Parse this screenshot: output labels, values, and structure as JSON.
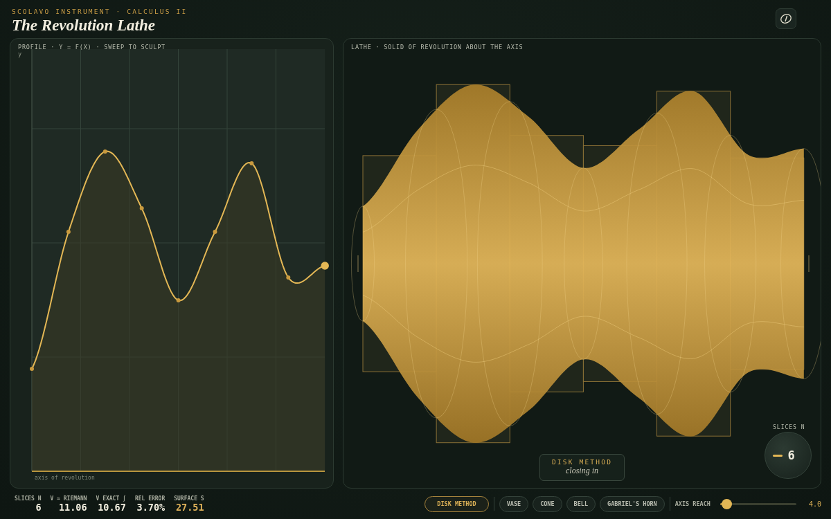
{
  "header": {
    "eyebrow": "SCOLAVO INSTRUMENT · CALCULUS II",
    "title": "The Revolution Lathe"
  },
  "profile_panel": {
    "title": "PROFILE · Y = F(X) · SWEEP TO SCULPT",
    "y_label": "y",
    "axis_label": "axis of revolution"
  },
  "lathe_panel": {
    "title": "LATHE · SOLID OF REVOLUTION ABOUT THE AXIS",
    "method_badge": {
      "title": "DISK METHOD",
      "subtitle": "closing in"
    },
    "slices_knob": {
      "label": "SLICES N",
      "value": "6"
    }
  },
  "stats": [
    {
      "label": "SLICES N",
      "value": "6",
      "highlight": false
    },
    {
      "label": "V ≈ RIEMANN",
      "value": "11.06",
      "highlight": false
    },
    {
      "label": "V EXACT ∫",
      "value": "10.67",
      "highlight": false
    },
    {
      "label": "REL ERROR",
      "value": "3.70%",
      "highlight": false
    },
    {
      "label": "SURFACE S",
      "value": "27.51",
      "highlight": true
    }
  ],
  "presets": [
    {
      "label": "DISK METHOD",
      "selected": true
    },
    {
      "label": "VASE",
      "selected": false
    },
    {
      "label": "CONE",
      "selected": false
    },
    {
      "label": "BELL",
      "selected": false
    },
    {
      "label": "GABRIEL'S HORN",
      "selected": false
    }
  ],
  "axis_reach": {
    "label": "AXIS REACH",
    "level": 0.08,
    "reading": "4.0"
  }
}
